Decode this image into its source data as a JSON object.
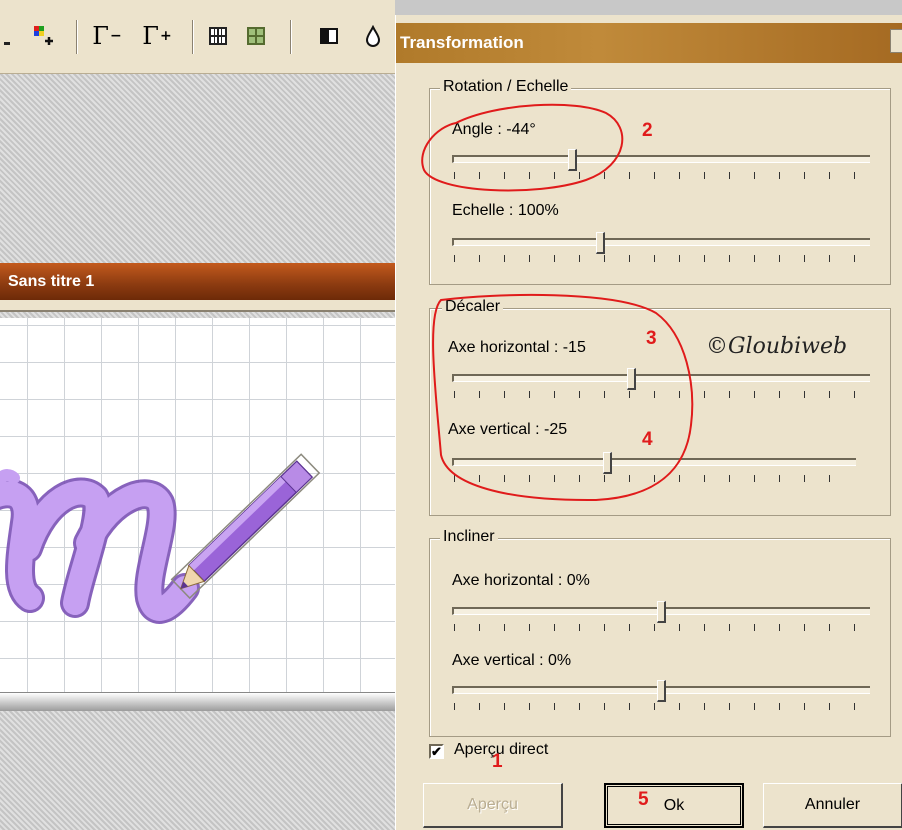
{
  "toolbar": {
    "icons": [
      "color-add-icon",
      "gamma-minus-icon",
      "gamma-plus-icon",
      "grid-icon",
      "grid-green-icon",
      "split-icon",
      "drop-icon"
    ],
    "gamma_minus": "Γ",
    "gamma_plus": "Γ",
    "minus_sub": "−",
    "plus_sub": "+"
  },
  "document": {
    "title": "Sans titre 1"
  },
  "dialog": {
    "title": "Transformation",
    "rotation_group": {
      "label": "Rotation / Echelle",
      "angle_label": "Angle : -44°",
      "angle_value": 0.29,
      "scale_label": "Echelle : 100%",
      "scale_value": 0.35
    },
    "offset_group": {
      "label": "Décaler",
      "horizontal_label": "Axe horizontal : -15",
      "horizontal_value": 0.43,
      "vertical_label": "Axe vertical : -25",
      "vertical_value": 0.38
    },
    "skew_group": {
      "label": "Incliner",
      "horizontal_label": "Axe horizontal : 0%",
      "horizontal_value": 0.5,
      "vertical_label": "Axe vertical : 0%",
      "vertical_value": 0.5
    },
    "live_preview": {
      "label": "Aperçu direct",
      "checked": true
    },
    "buttons": {
      "preview": "Aperçu",
      "ok": "Ok",
      "cancel": "Annuler"
    },
    "watermark": "©Gloubiweb"
  },
  "annotations": {
    "n1": "1",
    "n2": "2",
    "n3": "3",
    "n4": "4",
    "n5": "5"
  },
  "colors": {
    "dialog_bg": "#ece3cc",
    "titlebar": "#b07a2a",
    "doc_titlebar": "#8a3a10",
    "annotation": "#e01b1b",
    "letter": "#b98be6"
  }
}
